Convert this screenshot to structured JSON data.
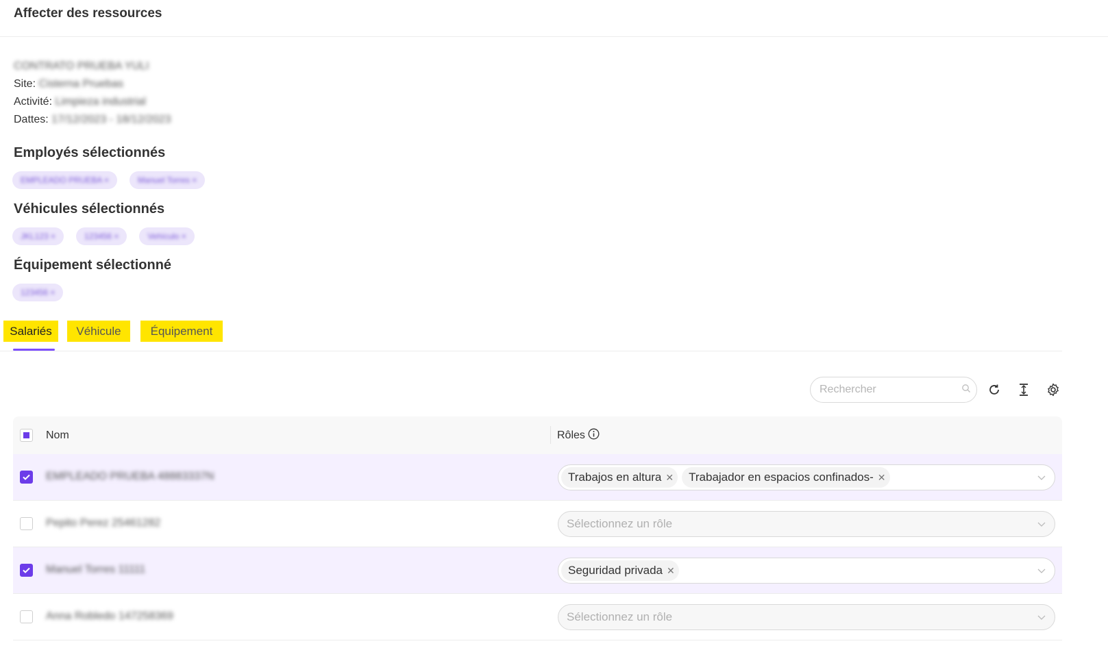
{
  "header": {
    "title": "Affecter des ressources"
  },
  "info": {
    "contract": "CONTRATO PRUEBA YULI",
    "site_label": "Site:",
    "site_value": "Cisterna Pruebas",
    "activity_label": "Activité:",
    "activity_value": "Limpieza industrial",
    "dates_label": "Dattes:",
    "dates_value": "17/12/2023 - 18/12/2023"
  },
  "selected": {
    "employees_title": "Employés sélectionnés",
    "employees": [
      "EMPLEADO PRUEBA ×",
      "Manuel Torres ×"
    ],
    "vehicles_title": "Véhicules sélectionnés",
    "vehicles": [
      "JKL123 ×",
      "123456 ×",
      "Vehículo ×"
    ],
    "equipment_title": "Équipement sélectionné",
    "equipment": [
      "123456 ×"
    ]
  },
  "tabs": [
    {
      "label": "Salariés",
      "active": true
    },
    {
      "label": "Véhicule",
      "active": false
    },
    {
      "label": "Équipement",
      "active": false
    }
  ],
  "toolbar": {
    "search_placeholder": "Rechercher",
    "icons": [
      "search-icon",
      "refresh-icon",
      "column-height-icon",
      "settings-icon"
    ]
  },
  "table": {
    "col_name": "Nom",
    "col_roles": "Rôles",
    "role_placeholder": "Sélectionnez un rôle",
    "rows": [
      {
        "name": "EMPLEADO PRUEBA 48883337N",
        "checked": true,
        "roles": [
          "Trabajos en altura",
          "Trabajador en espacios confinados-"
        ]
      },
      {
        "name": "Pepito Perez 25461282",
        "checked": false,
        "roles": []
      },
      {
        "name": "Manuel Torres 11111",
        "checked": true,
        "roles": [
          "Seguridad privada"
        ]
      },
      {
        "name": "Anna Robledo 147258369",
        "checked": false,
        "roles": []
      }
    ]
  },
  "colors": {
    "accent": "#6c3ce9",
    "tab_highlight": "#ffe500",
    "chip_bg": "#ece6fb",
    "selected_row": "#f5f0ff"
  }
}
